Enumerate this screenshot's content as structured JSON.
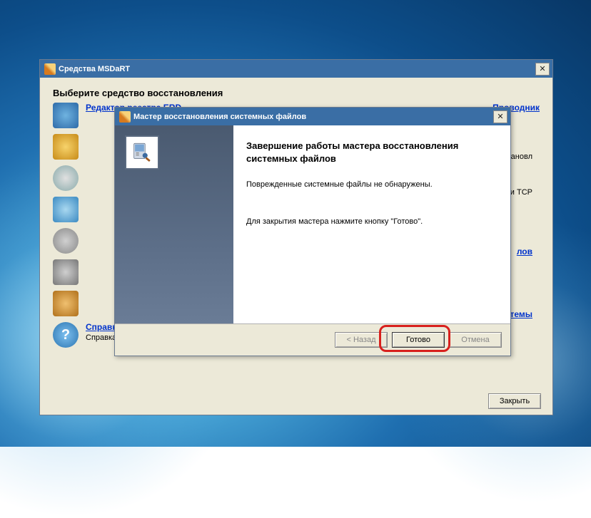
{
  "desktop": {},
  "main_window": {
    "title": "Средства MSDaRT",
    "heading": "Выберите средство восстановления",
    "left_items": [
      {
        "label": "Редактор реестра ERD"
      }
    ],
    "right_items": [
      {
        "label": "Проводник"
      }
    ],
    "fragments": {
      "line1": "ановл",
      "line2": "и TCP",
      "link1": "лов",
      "link2": "стемы"
    },
    "help": {
      "link": "Справка",
      "text": "Справка средств MSDaRT"
    },
    "close_button": "Закрыть"
  },
  "wizard": {
    "title": "Мастер восстановления системных файлов",
    "heading": "Завершение работы мастера восстановления системных файлов",
    "msg1": "Поврежденные системные файлы не обнаружены.",
    "msg2": "Для закрытия мастера нажмите кнопку \"Готово\".",
    "back": "< Назад",
    "finish": "Готово",
    "cancel": "Отмена"
  }
}
